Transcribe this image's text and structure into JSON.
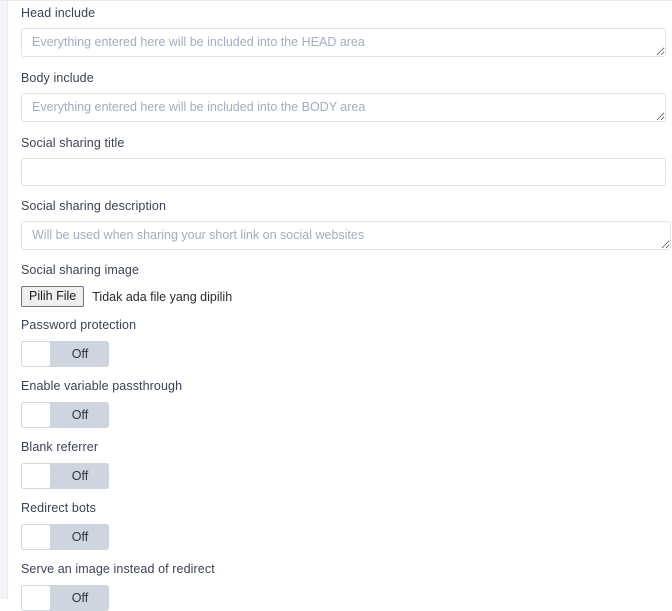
{
  "form": {
    "fields": [
      {
        "id": "head-include",
        "label": "Head include",
        "type": "textarea",
        "value": "",
        "placeholder": "Everything entered here will be included into the HEAD area"
      },
      {
        "id": "body-include",
        "label": "Body include",
        "type": "textarea",
        "value": "",
        "placeholder": "Everything entered here will be included into the BODY area"
      },
      {
        "id": "social-sharing-title",
        "label": "Social sharing title",
        "type": "text",
        "value": "",
        "placeholder": ""
      },
      {
        "id": "social-sharing-description",
        "label": "Social sharing description",
        "type": "textarea",
        "value": "",
        "placeholder": "Will be used when sharing your short link on social websites"
      },
      {
        "id": "social-sharing-image",
        "label": "Social sharing image",
        "type": "file",
        "button_label": "Pilih File",
        "status_text": "Tidak ada file yang dipilih"
      },
      {
        "id": "password-protection",
        "label": "Password protection",
        "type": "toggle",
        "state_label": "Off",
        "checked": false
      },
      {
        "id": "enable-variable-passthrough",
        "label": "Enable variable passthrough",
        "type": "toggle",
        "state_label": "Off",
        "checked": false
      },
      {
        "id": "blank-referrer",
        "label": "Blank referrer",
        "type": "toggle",
        "state_label": "Off",
        "checked": false
      },
      {
        "id": "redirect-bots",
        "label": "Redirect bots",
        "type": "toggle",
        "state_label": "Off",
        "checked": false
      },
      {
        "id": "serve-an-image-instead-of-redirect",
        "label": "Serve an image instead of redirect",
        "type": "toggle",
        "state_label": "Off",
        "checked": false
      }
    ]
  },
  "colors": {
    "label_text": "#3c4257",
    "placeholder_text": "#a3adbf",
    "input_border": "#dfe3ec",
    "toggle_track": "#ced5de",
    "toggle_knob": "#ffffff",
    "gutter": "#f4f5f9",
    "page_background": "#ffffff"
  }
}
